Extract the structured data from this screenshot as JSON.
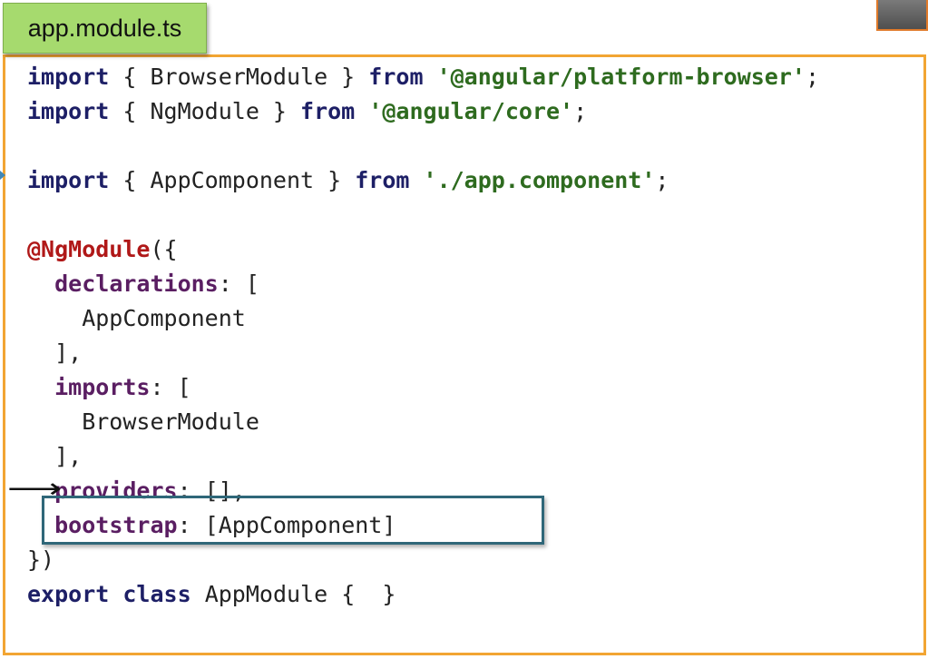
{
  "title_tab": {
    "label": "app.module.ts"
  },
  "code": {
    "lines": [
      {
        "tokens": [
          {
            "type": "kw",
            "text": "import"
          },
          {
            "type": "plain",
            "text": " { BrowserModule } "
          },
          {
            "type": "kw",
            "text": "from"
          },
          {
            "type": "plain",
            "text": " "
          },
          {
            "type": "str",
            "text": "'@angular/platform-browser'"
          },
          {
            "type": "plain",
            "text": ";"
          }
        ]
      },
      {
        "tokens": [
          {
            "type": "kw",
            "text": "import"
          },
          {
            "type": "plain",
            "text": " { NgModule } "
          },
          {
            "type": "kw",
            "text": "from"
          },
          {
            "type": "plain",
            "text": " "
          },
          {
            "type": "str",
            "text": "'@angular/core'"
          },
          {
            "type": "plain",
            "text": ";"
          }
        ]
      },
      {
        "tokens": []
      },
      {
        "tokens": [
          {
            "type": "kw",
            "text": "import"
          },
          {
            "type": "plain",
            "text": " { AppComponent } "
          },
          {
            "type": "kw",
            "text": "from"
          },
          {
            "type": "plain",
            "text": " "
          },
          {
            "type": "str",
            "text": "'./app.component'"
          },
          {
            "type": "plain",
            "text": ";"
          }
        ]
      },
      {
        "tokens": []
      },
      {
        "tokens": [
          {
            "type": "dec",
            "text": "@NgModule"
          },
          {
            "type": "plain",
            "text": "({"
          }
        ]
      },
      {
        "tokens": [
          {
            "type": "plain",
            "text": "  "
          },
          {
            "type": "prop",
            "text": "declarations"
          },
          {
            "type": "plain",
            "text": ": ["
          }
        ]
      },
      {
        "tokens": [
          {
            "type": "plain",
            "text": "    AppComponent"
          }
        ]
      },
      {
        "tokens": [
          {
            "type": "plain",
            "text": "  ],"
          }
        ]
      },
      {
        "tokens": [
          {
            "type": "plain",
            "text": "  "
          },
          {
            "type": "prop",
            "text": "imports"
          },
          {
            "type": "plain",
            "text": ": ["
          }
        ]
      },
      {
        "tokens": [
          {
            "type": "plain",
            "text": "    BrowserModule"
          }
        ]
      },
      {
        "tokens": [
          {
            "type": "plain",
            "text": "  ],"
          }
        ]
      },
      {
        "tokens": [
          {
            "type": "plain",
            "text": "  "
          },
          {
            "type": "prop",
            "text": "providers"
          },
          {
            "type": "plain",
            "text": ": [],"
          }
        ]
      },
      {
        "tokens": [
          {
            "type": "plain",
            "text": "  "
          },
          {
            "type": "prop",
            "text": "bootstrap"
          },
          {
            "type": "plain",
            "text": ": [AppComponent]"
          }
        ]
      },
      {
        "tokens": [
          {
            "type": "plain",
            "text": "})"
          }
        ]
      },
      {
        "tokens": [
          {
            "type": "kw",
            "text": "export"
          },
          {
            "type": "plain",
            "text": " "
          },
          {
            "type": "kw",
            "text": "class"
          },
          {
            "type": "plain",
            "text": " AppModule {  }"
          }
        ]
      }
    ]
  },
  "annotations": {
    "arrow_glyph": "⟶",
    "arrow_target_line": 12,
    "highlighted_line": 13
  },
  "colors": {
    "keyword": "#1d1f66",
    "string": "#2e6b1f",
    "decorator": "#b01818",
    "property": "#5a1e62",
    "frame_border": "#f2a533",
    "title_tab_bg": "#a6da6e",
    "highlight_border": "#2f6779"
  }
}
